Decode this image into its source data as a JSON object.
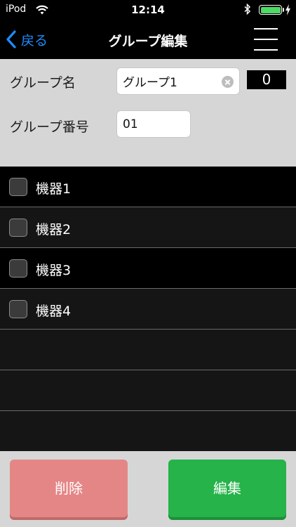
{
  "status_bar": {
    "carrier": "iPod",
    "time": "12:14"
  },
  "nav": {
    "back_label": "戻る",
    "title": "グループ編集"
  },
  "form": {
    "group_name_label": "グループ名",
    "group_name_value": "グループ1",
    "count": "0",
    "group_number_label": "グループ番号",
    "group_number_value": "01"
  },
  "devices": [
    {
      "label": "機器1"
    },
    {
      "label": "機器2"
    },
    {
      "label": "機器3"
    },
    {
      "label": "機器4"
    }
  ],
  "buttons": {
    "delete": "削除",
    "edit": "編集"
  },
  "colors": {
    "accent": "#1e8cff",
    "battery": "#4cd964",
    "delete": "#e58686",
    "edit": "#25b34a"
  }
}
